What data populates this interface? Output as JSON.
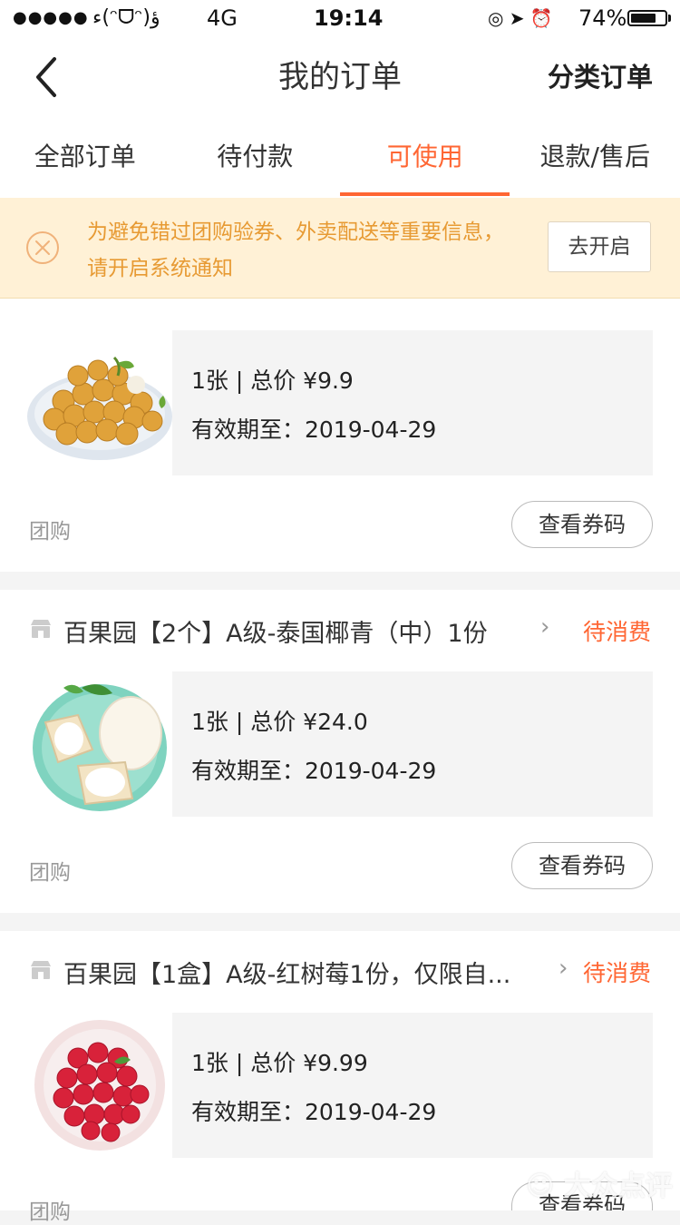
{
  "status_bar": {
    "signal": "●●●●●",
    "carrier": "ء(ᵔᗜᵔ)ؤ",
    "network": "4G",
    "time": "19:14",
    "icons": "◎ ➤ ⏰",
    "battery_pct": "74%",
    "battery_level": 0.74
  },
  "nav": {
    "title": "我的订单",
    "right_action": "分类订单"
  },
  "tabs": [
    {
      "label": "全部订单",
      "active": false
    },
    {
      "label": "待付款",
      "active": false
    },
    {
      "label": "可使用",
      "active": true
    },
    {
      "label": "退款/售后",
      "active": false
    }
  ],
  "banner": {
    "text": "为避免错过团购验券、外卖配送等重要信息，请开启系统通知",
    "button": "去开启"
  },
  "orders": [
    {
      "quantity_price": "1张 | 总价 ¥9.9",
      "expiry": "有效期至：2019-04-29",
      "type": "团购",
      "button": "查看券码"
    },
    {
      "title": "百果园【2个】A级-泰国椰青（中）1份",
      "status": "待消费",
      "quantity_price": "1张 | 总价 ¥24.0",
      "expiry": "有效期至：2019-04-29",
      "type": "团购",
      "button": "查看券码"
    },
    {
      "title": "百果园【1盒】A级-红树莓1份，仅限自...",
      "status": "待消费",
      "quantity_price": "1张 | 总价 ¥9.99",
      "expiry": "有效期至：2019-04-29",
      "type": "团购",
      "button": "查看券码"
    }
  ],
  "watermark": "大众点评",
  "colors": {
    "accent": "#ff6633",
    "banner_bg": "#fff1d6",
    "banner_text": "#e79a33"
  }
}
